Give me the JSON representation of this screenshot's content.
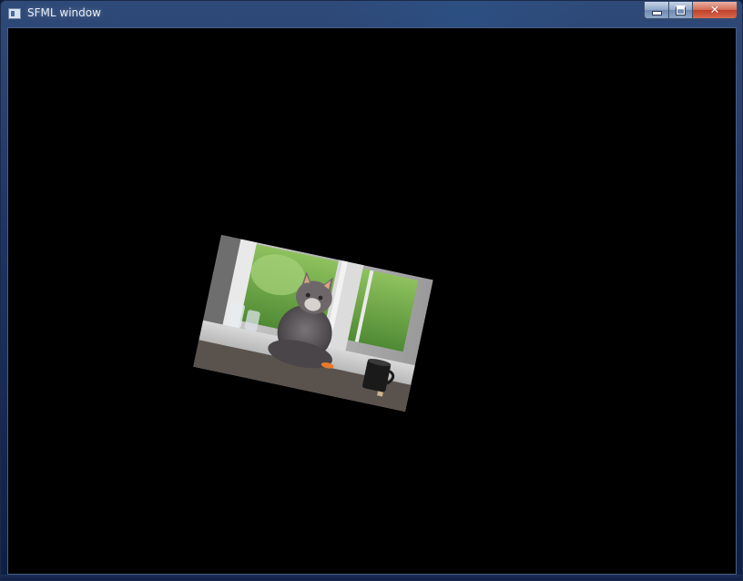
{
  "window": {
    "title": "SFML window",
    "controls": {
      "minimize": "minimize",
      "maximize": "maximize",
      "close": "close"
    }
  },
  "sprite": {
    "description": "cat-photo-sprite",
    "rotation_deg": 12
  },
  "colors": {
    "client_background": "#000000",
    "titlebar": "#1d3565",
    "close_button": "#c0412a"
  },
  "icons": [
    "app-icon",
    "minimize-icon",
    "maximize-icon",
    "close-icon"
  ]
}
